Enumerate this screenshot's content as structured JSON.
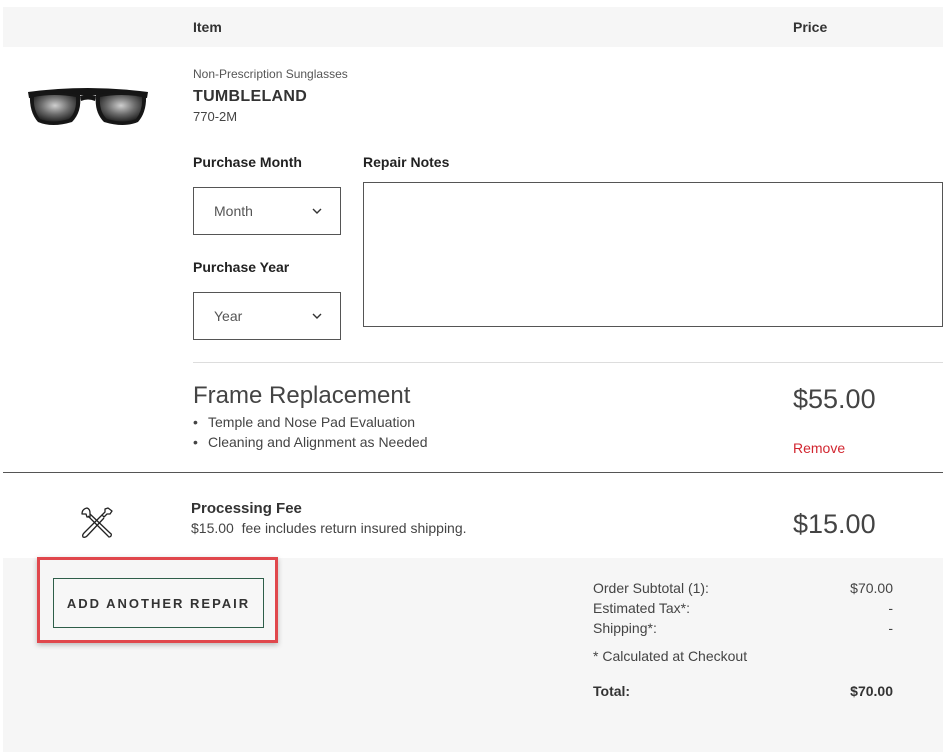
{
  "header": {
    "item_label": "Item",
    "price_label": "Price"
  },
  "product": {
    "category": "Non-Prescription Sunglasses",
    "name": "TUMBLELAND",
    "sku": "770-2M"
  },
  "form": {
    "purchase_month_label": "Purchase Month",
    "month_value": "Month",
    "purchase_year_label": "Purchase Year",
    "year_value": "Year",
    "repair_notes_label": "Repair Notes",
    "repair_notes_value": ""
  },
  "service": {
    "title": "Frame Replacement",
    "bullets": [
      "Temple and Nose Pad Evaluation",
      "Cleaning and Alignment as Needed"
    ],
    "price": "$55.00",
    "remove_label": "Remove"
  },
  "fee": {
    "title": "Processing Fee",
    "description": "$15.00  fee includes return insured shipping.",
    "price": "$15.00"
  },
  "actions": {
    "add_repair_label": "ADD ANOTHER REPAIR"
  },
  "summary": {
    "subtotal_label": "Order Subtotal (1):",
    "subtotal_value": "$70.00",
    "tax_label": "Estimated Tax*:",
    "tax_value": "-",
    "shipping_label": "Shipping*:",
    "shipping_value": "-",
    "note": "* Calculated at Checkout",
    "total_label": "Total:",
    "total_value": "$70.00"
  },
  "colors": {
    "remove": "#d22630",
    "highlight": "#e0474c",
    "button_border": "#2e5e49",
    "panel_bg": "#f6f6f6"
  },
  "icons": {
    "product": "sunglasses-image",
    "fee": "tools-icon",
    "select": "chevron-down-icon"
  }
}
